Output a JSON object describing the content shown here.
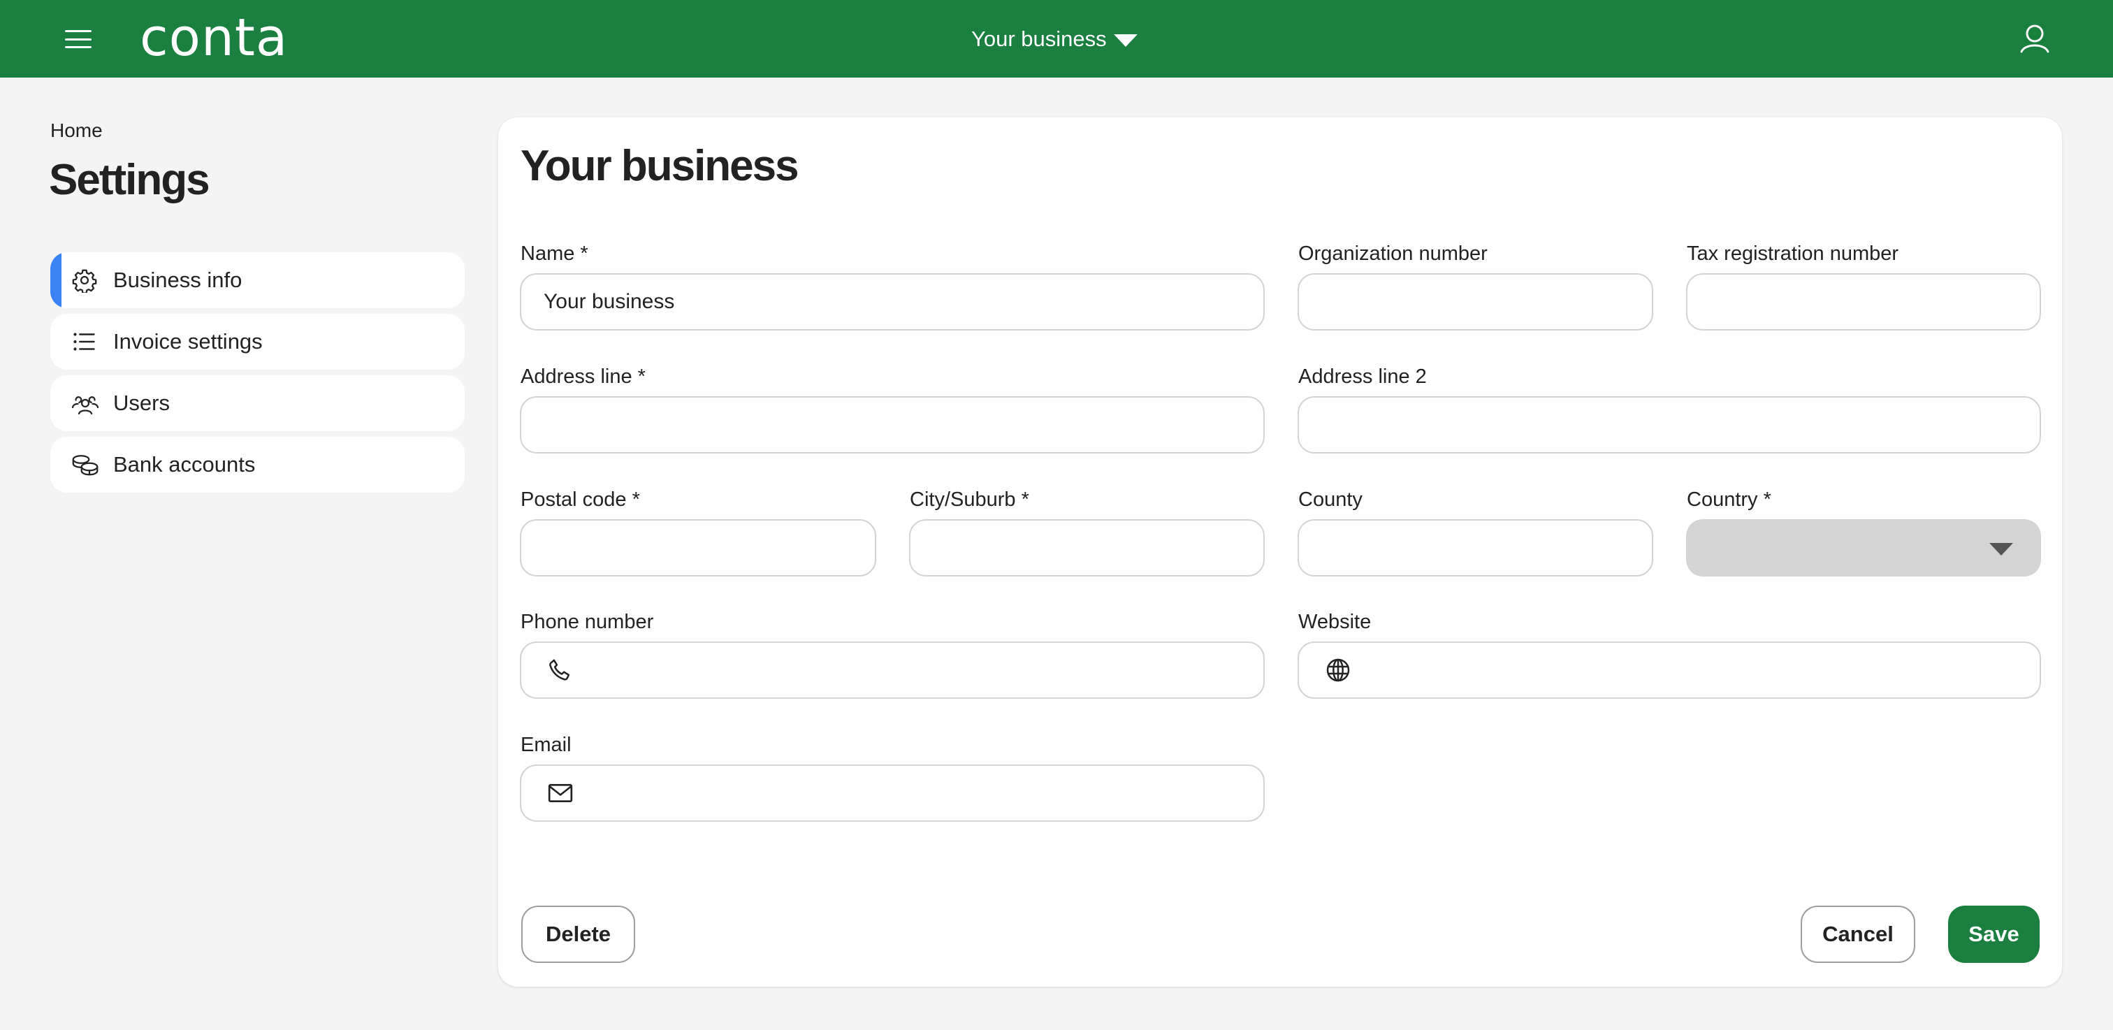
{
  "topbar": {
    "menu_icon": "hamburger-menu-icon",
    "logo_text": "conta",
    "business_switcher_label": "Your business",
    "business_switcher_icon": "caret-down-icon",
    "user_icon": "user-icon",
    "brand_color": "#1a7f3f"
  },
  "sidebar": {
    "breadcrumb": "Home",
    "title": "Settings",
    "active_accent_color": "#3b82f6",
    "items": [
      {
        "label": "Business info",
        "icon": "gear-icon",
        "active": true
      },
      {
        "label": "Invoice settings",
        "icon": "list-icon",
        "active": false
      },
      {
        "label": "Users",
        "icon": "users-icon",
        "active": false
      },
      {
        "label": "Bank accounts",
        "icon": "coins-icon",
        "active": false
      }
    ]
  },
  "form": {
    "title": "Your business",
    "fields": {
      "name": {
        "label": "Name *",
        "value": "Your business"
      },
      "org_number": {
        "label": "Organization number",
        "value": ""
      },
      "tax_number": {
        "label": "Tax registration number",
        "value": ""
      },
      "address1": {
        "label": "Address line *",
        "value": ""
      },
      "address2": {
        "label": "Address line 2",
        "value": ""
      },
      "postal_code": {
        "label": "Postal code *",
        "value": ""
      },
      "city": {
        "label": "City/Suburb *",
        "value": ""
      },
      "county": {
        "label": "County",
        "value": ""
      },
      "country": {
        "label": "Country *",
        "value": ""
      },
      "phone": {
        "label": "Phone number",
        "value": "",
        "icon": "phone-icon"
      },
      "website": {
        "label": "Website",
        "value": "",
        "icon": "globe-icon"
      },
      "email": {
        "label": "Email",
        "value": "",
        "icon": "mail-icon"
      }
    },
    "buttons": {
      "delete": "Delete",
      "cancel": "Cancel",
      "save": "Save"
    }
  }
}
